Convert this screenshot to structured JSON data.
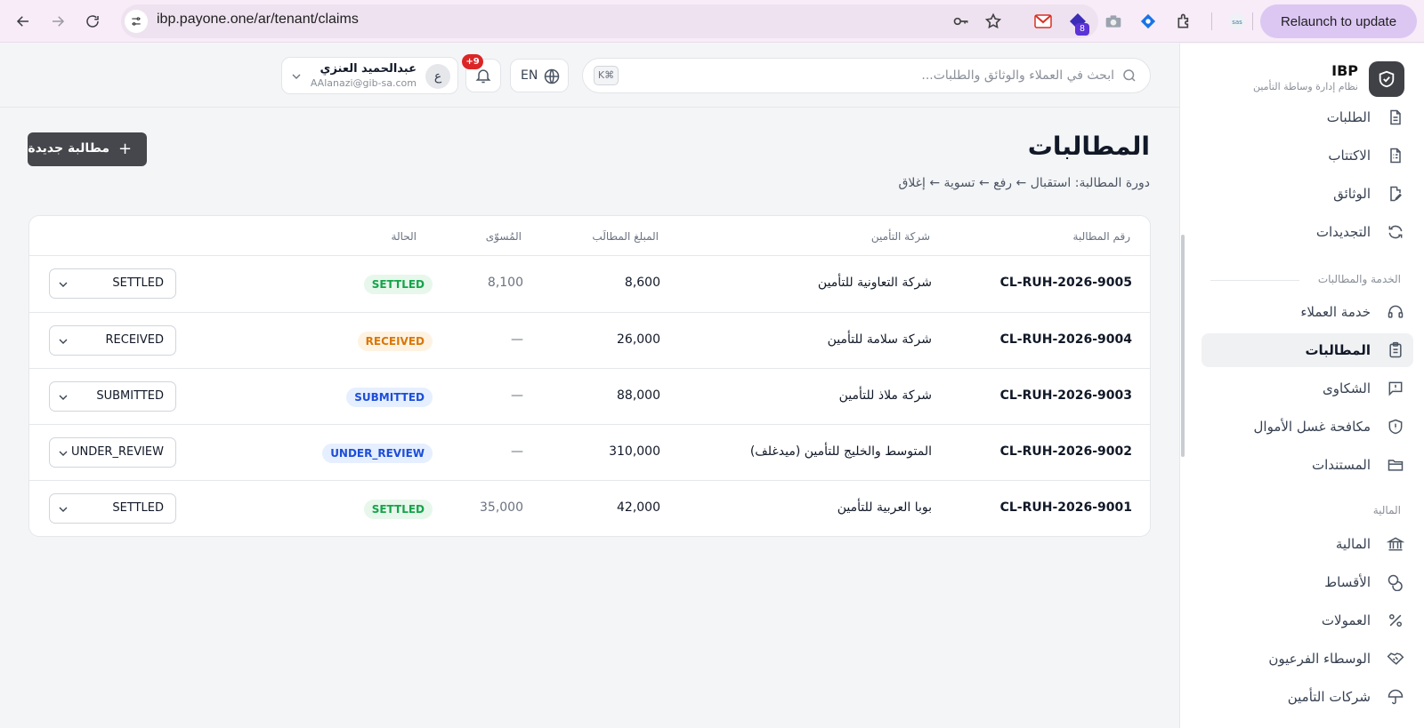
{
  "browser": {
    "url": "ibp.payone.one/ar/tenant/claims",
    "relaunch_label": "Relaunch to update",
    "ext_badge": "8"
  },
  "brand": {
    "name": "IBP",
    "subtitle": "نظام إدارة وساطة التأمين"
  },
  "sidebar": {
    "items_top": [
      {
        "label": "الطلبات",
        "icon": "document-icon"
      },
      {
        "label": "الاكتتاب",
        "icon": "checklist-document-icon"
      },
      {
        "label": "الوثائق",
        "icon": "file-edit-icon"
      },
      {
        "label": "التجديدات",
        "icon": "refresh-icon"
      }
    ],
    "section_service": "الخدمة والمطالبات",
    "items_service": [
      {
        "label": "خدمة العملاء",
        "icon": "headset-icon"
      },
      {
        "label": "المطالبات",
        "icon": "clipboard-icon",
        "active": true
      },
      {
        "label": "الشكاوى",
        "icon": "message-alert-icon"
      },
      {
        "label": "مكافحة غسل الأموال",
        "icon": "shield-icon"
      },
      {
        "label": "المستندات",
        "icon": "folder-icon"
      }
    ],
    "section_finance": "المالية",
    "items_finance": [
      {
        "label": "المالية",
        "icon": "bank-icon"
      },
      {
        "label": "الأقساط",
        "icon": "coins-icon"
      },
      {
        "label": "العمولات",
        "icon": "percent-icon"
      },
      {
        "label": "الوسطاء الفرعيون",
        "icon": "handshake-icon"
      },
      {
        "label": "شركات التأمين",
        "icon": "umbrella-icon"
      }
    ]
  },
  "header": {
    "search_placeholder": "ابحث في العملاء والوثائق والطلبات...",
    "search_shortcut": "K⌘",
    "lang_label": "EN",
    "notif_count": "+9",
    "user_name": "عبدالحميد العنزي",
    "user_email": "AAlanazi@gib-sa.com",
    "user_initial": "ع"
  },
  "page": {
    "title": "المطالبات",
    "subtitle": "دورة المطالبة: استقبال ← رفع ← تسوية ← إغلاق",
    "new_button": "مطالبة جديدة"
  },
  "table": {
    "columns": {
      "id": "رقم المطالبة",
      "company": "شركة التأمين",
      "amount": "المبلغ المطالَب",
      "settled": "المُسوّى",
      "status": "الحالة"
    },
    "rows": [
      {
        "id": "CL-RUH-2026-9005",
        "company": "شركة التعاونية للتأمين",
        "amount": "8,600",
        "settled": "8,100",
        "status": "SETTLED",
        "select": "SETTLED"
      },
      {
        "id": "CL-RUH-2026-9004",
        "company": "شركة سلامة للتأمين",
        "amount": "26,000",
        "settled": "—",
        "status": "RECEIVED",
        "select": "RECEIVED"
      },
      {
        "id": "CL-RUH-2026-9003",
        "company": "شركة ملاذ للتأمين",
        "amount": "88,000",
        "settled": "—",
        "status": "SUBMITTED",
        "select": "SUBMITTED"
      },
      {
        "id": "CL-RUH-2026-9002",
        "company": "المتوسط والخليج للتأمين (ميدغلف)",
        "amount": "310,000",
        "settled": "—",
        "status": "UNDER_REVIEW",
        "select": "UNDER_REVIEW"
      },
      {
        "id": "CL-RUH-2026-9001",
        "company": "بوبا العربية للتأمين",
        "amount": "42,000",
        "settled": "35,000",
        "status": "SETTLED",
        "select": "SETTLED"
      }
    ]
  },
  "colors": {
    "settled": "#16a34a",
    "received": "#d97706",
    "submitted": "#1d4ed8",
    "primary_button": "#45474c",
    "notif_badge": "#dc2626"
  }
}
